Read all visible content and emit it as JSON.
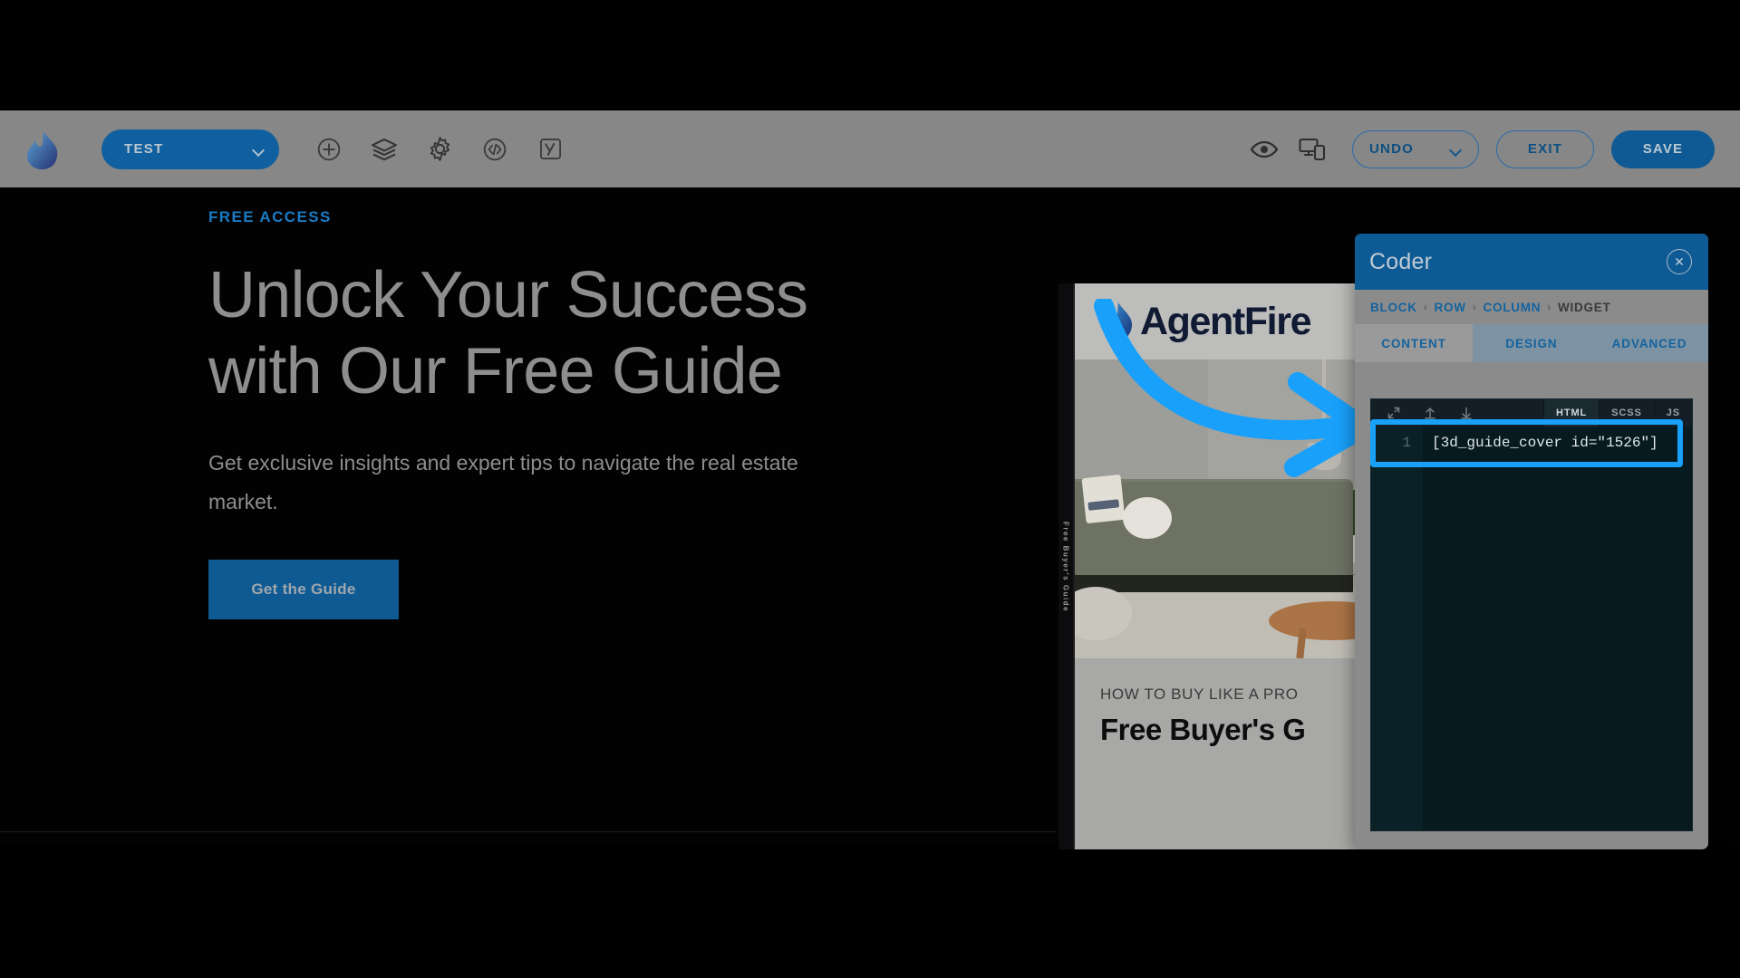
{
  "toolbar": {
    "logo_name": "agentfire-flame-logo",
    "site_selector": {
      "label": "TEST"
    },
    "icons": [
      {
        "name": "add-icon",
        "title": "Add"
      },
      {
        "name": "layers-icon",
        "title": "Layers"
      },
      {
        "name": "settings-gear-icon",
        "title": "Settings"
      },
      {
        "name": "code-icon",
        "title": "Code"
      },
      {
        "name": "yoast-seo-icon",
        "title": "Yoast SEO"
      }
    ],
    "right_icons": [
      {
        "name": "preview-eye-icon",
        "title": "Preview"
      },
      {
        "name": "responsive-device-icon",
        "title": "Responsive"
      }
    ],
    "undo_label": "UNDO",
    "exit_label": "EXIT",
    "save_label": "SAVE"
  },
  "hero": {
    "eyebrow": "FREE ACCESS",
    "heading_line1": "Unlock Your Success",
    "heading_line2": "with Our Free Guide",
    "body": "Get exclusive insights and expert tips to navigate the real estate market.",
    "cta_label": "Get the Guide"
  },
  "book": {
    "spine_text": "Free Buyer's Guide",
    "brand": "AgentFire",
    "kicker": "HOW TO BUY LIKE A PRO",
    "title": "Free Buyer's G"
  },
  "coder": {
    "title": "Coder",
    "close_label": "✕",
    "breadcrumbs": [
      "BLOCK",
      "ROW",
      "COLUMN",
      "WIDGET"
    ],
    "breadcrumb_separator": "›",
    "tabs": [
      {
        "label": "CONTENT",
        "active": true
      },
      {
        "label": "DESIGN",
        "active": false
      },
      {
        "label": "ADVANCED",
        "active": false
      }
    ],
    "editor": {
      "languages": [
        {
          "label": "HTML",
          "active": true
        },
        {
          "label": "SCSS",
          "active": false
        },
        {
          "label": "JS",
          "active": false
        }
      ],
      "tools": [
        "expand-arrows-icon",
        "arrow-up-icon",
        "arrow-down-icon"
      ],
      "line_number": "1",
      "code": "[3d_guide_cover id=\"1526\"]"
    }
  },
  "annotation": {
    "arrow_name": "curved-arrow-annotation",
    "arrow_color": "#18a0fb",
    "highlight_color": "#18a0fb"
  },
  "colors": {
    "toolbar_bg": "#878787",
    "accent_blue": "#0f5a94",
    "panel_bg": "#8b8b8b",
    "editor_bg": "#071a1f",
    "annotation_cyan": "#18a0fb"
  }
}
